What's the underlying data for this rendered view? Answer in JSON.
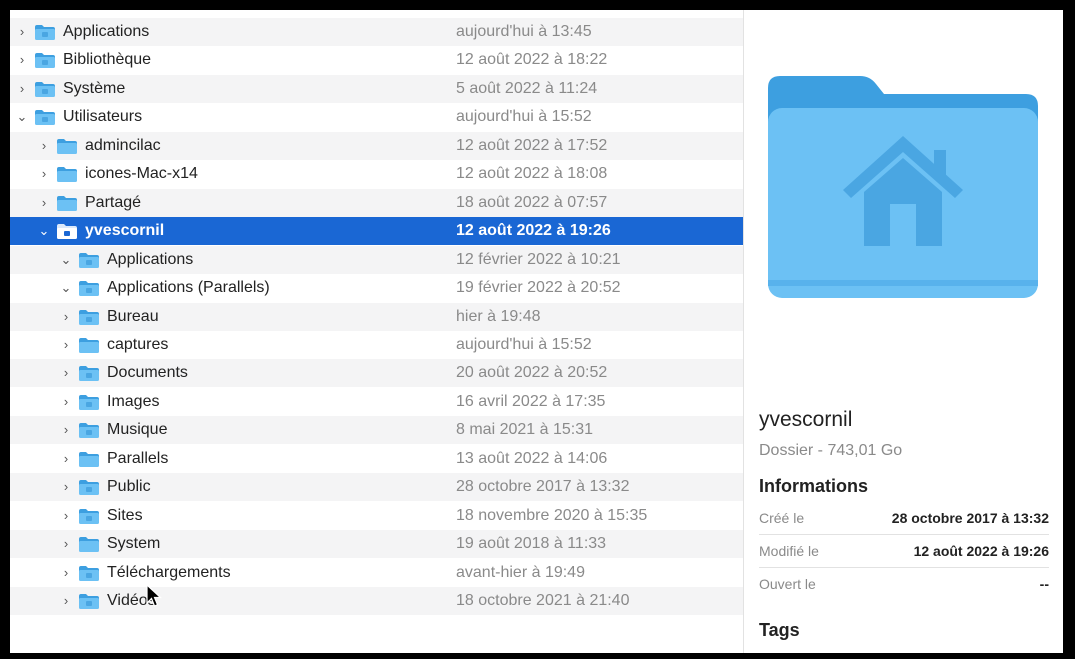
{
  "rows": [
    {
      "name": "Applications",
      "date": "aujourd'hui à 13:45",
      "expanded": false,
      "icon": "applications-folder-icon"
    },
    {
      "name": "Bibliothèque",
      "date": "12 août 2022 à 18:22",
      "expanded": false,
      "icon": "library-folder-icon"
    },
    {
      "name": "Système",
      "date": "5 août 2022 à 11:24",
      "expanded": false,
      "icon": "system-folder-icon"
    },
    {
      "name": "Utilisateurs",
      "date": "aujourd'hui à 15:52",
      "expanded": true,
      "icon": "users-folder-icon"
    },
    {
      "name": "admincilac",
      "date": "12 août 2022 à 17:52",
      "expanded": false,
      "icon": "folder-icon"
    },
    {
      "name": "icones-Mac-x14",
      "date": "12 août 2022 à 18:08",
      "expanded": false,
      "icon": "folder-icon"
    },
    {
      "name": "Partagé",
      "date": "18 août 2022 à 07:57",
      "expanded": false,
      "icon": "folder-icon"
    },
    {
      "name": "yvescornil",
      "date": "12 août 2022 à 19:26",
      "expanded": true,
      "selected": true,
      "icon": "home-folder-icon"
    },
    {
      "name": "Applications",
      "date": "12 février 2022 à 10:21",
      "expanded": true,
      "icon": "applications-folder-icon"
    },
    {
      "name": "Applications (Parallels)",
      "date": "19 février 2022 à 20:52",
      "expanded": true,
      "icon": "parallels-applications-folder-icon"
    },
    {
      "name": "Bureau",
      "date": "hier à 19:48",
      "expanded": false,
      "icon": "desktop-folder-icon"
    },
    {
      "name": "captures",
      "date": "aujourd'hui à 15:52",
      "expanded": false,
      "icon": "folder-icon"
    },
    {
      "name": "Documents",
      "date": "20 août 2022 à 20:52",
      "expanded": false,
      "icon": "documents-folder-icon"
    },
    {
      "name": "Images",
      "date": "16 avril 2022 à 17:35",
      "expanded": false,
      "icon": "pictures-folder-icon"
    },
    {
      "name": "Musique",
      "date": "8 mai 2021 à 15:31",
      "expanded": false,
      "icon": "music-folder-icon"
    },
    {
      "name": "Parallels",
      "date": "13 août 2022 à 14:06",
      "expanded": false,
      "icon": "folder-icon"
    },
    {
      "name": "Public",
      "date": "28 octobre 2017 à 13:32",
      "expanded": false,
      "icon": "public-folder-icon"
    },
    {
      "name": "Sites",
      "date": "18 novembre 2020 à 15:35",
      "expanded": false,
      "icon": "sites-folder-icon"
    },
    {
      "name": "System",
      "date": "19 août 2018 à 11:33",
      "expanded": false,
      "icon": "folder-icon"
    },
    {
      "name": "Téléchargements",
      "date": "avant-hier à 19:49",
      "expanded": false,
      "icon": "downloads-folder-icon"
    },
    {
      "name": "Vidéos",
      "date": "18 octobre 2021 à 21:40",
      "expanded": false,
      "icon": "movies-folder-icon"
    }
  ],
  "preview": {
    "name": "yvescornil",
    "subtitle": "Dossier - 743,01 Go",
    "info_heading": "Informations",
    "created_label": "Créé le",
    "created_value": "28 octobre 2017 à 13:32",
    "modified_label": "Modifié le",
    "modified_value": "12 août 2022 à 19:26",
    "opened_label": "Ouvert le",
    "opened_value": "--",
    "tags_heading": "Tags",
    "icon": "home-folder-icon"
  },
  "colors": {
    "selection": "#1a67d4",
    "folder_light": "#6cc1f4",
    "folder_dark": "#3d9fe0",
    "secondary_text": "#8a8a8a"
  }
}
